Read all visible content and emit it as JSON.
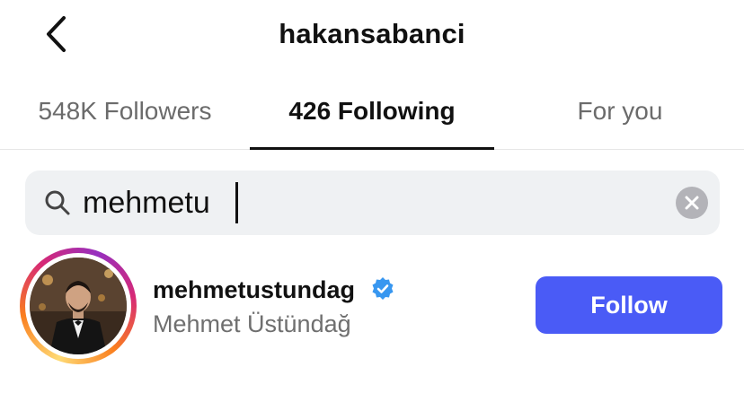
{
  "header": {
    "title": "hakansabanci",
    "back_icon": "chevron-left-icon"
  },
  "tabs": [
    {
      "label": "548K Followers",
      "active": false
    },
    {
      "label": "426 Following",
      "active": true
    },
    {
      "label": "For you",
      "active": false
    }
  ],
  "search": {
    "value": "mehmetu",
    "search_icon": "search-icon",
    "clear_icon": "clear-x-icon"
  },
  "results": [
    {
      "username": "mehmetustundag",
      "full_name": "Mehmet Üstündağ",
      "verified": true,
      "follow_label": "Follow",
      "has_story_ring": true
    }
  ],
  "colors": {
    "follow_button": "#4a5bf6",
    "verified_badge": "#3897f0",
    "search_bg": "#eff1f3",
    "inactive_tab": "#6b6b6b",
    "secondary_text": "#6f6f6f"
  }
}
